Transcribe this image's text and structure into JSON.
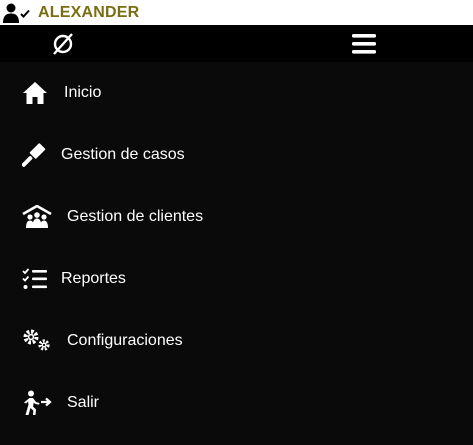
{
  "user": {
    "name": "ALEXANDER",
    "icon": "user-check-icon"
  },
  "header": {
    "logo_icon": "compass-slash-icon",
    "menu_icon": "hamburger-menu-icon"
  },
  "nav": {
    "items": [
      {
        "label": "Inicio",
        "icon": "home-icon"
      },
      {
        "label": "Gestion de casos",
        "icon": "gavel-icon"
      },
      {
        "label": "Gestion de clientes",
        "icon": "people-roof-icon"
      },
      {
        "label": "Reportes",
        "icon": "list-check-icon"
      },
      {
        "label": "Configuraciones",
        "icon": "gears-icon"
      },
      {
        "label": "Salir",
        "icon": "person-exit-icon"
      }
    ]
  },
  "colors": {
    "username": "#7a6e12",
    "sidebar_bg": "#0a0a0a",
    "topbar_bg": "#000000",
    "text": "#ffffff"
  }
}
